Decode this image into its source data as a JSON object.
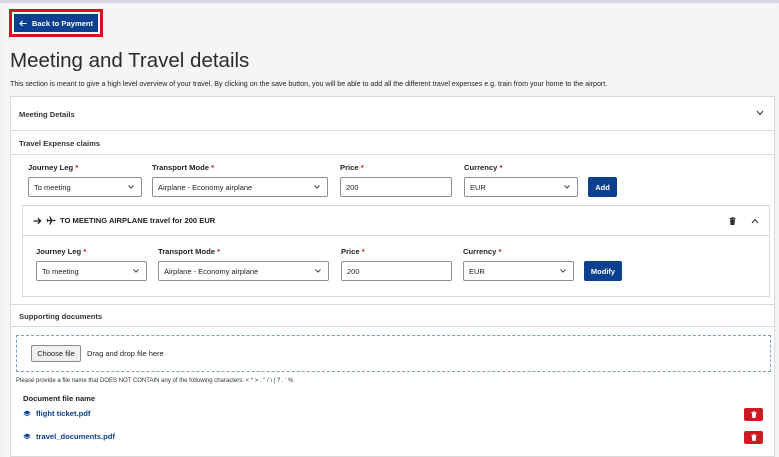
{
  "nav": {
    "back_label": "Back to Payment"
  },
  "page": {
    "title": "Meeting and Travel details",
    "intro": "This section is meant to give a high level overview of your travel. By clicking on the save button, you will be able to add all the different travel expenses e.g. train from your home to the airport."
  },
  "meeting_details": {
    "title": "Meeting Details"
  },
  "travel_expense": {
    "title": "Travel Expense claims",
    "form": {
      "journey_leg_label": "Journey Leg",
      "transport_mode_label": "Transport Mode",
      "price_label": "Price",
      "currency_label": "Currency",
      "required_mark": "*",
      "journey_leg_value": "To meeting",
      "transport_mode_value": "Airplane - Economy airplane",
      "price_value": "200",
      "currency_value": "EUR",
      "add_label": "Add"
    },
    "legs": [
      {
        "title": "TO MEETING AIRPLANE travel for 200 EUR",
        "journey_leg_value": "To meeting",
        "transport_mode_value": "Airplane - Economy airplane",
        "price_value": "200",
        "currency_value": "EUR",
        "modify_label": "Modify"
      }
    ]
  },
  "supporting_documents": {
    "title": "Supporting documents",
    "choose_file_label": "Choose file",
    "drop_text": "Drag and drop file here",
    "hint": "Please provide a file name that DOES NOT CONTAIN any of the following characters: < * > : \" / \\ | ? . ' %",
    "column_header": "Document file name",
    "files": [
      {
        "name": "flight ticket.pdf"
      },
      {
        "name": "travel_documents.pdf"
      }
    ]
  },
  "colors": {
    "primary": "#0b3f8f",
    "danger": "#cd1a22",
    "highlight": "#d6101c",
    "required": "#d0121b"
  },
  "icons": [
    "arrow-left-icon",
    "chevron-down-icon",
    "chevron-up-icon",
    "arrow-right-icon",
    "airplane-icon",
    "trash-icon",
    "file-icon"
  ]
}
